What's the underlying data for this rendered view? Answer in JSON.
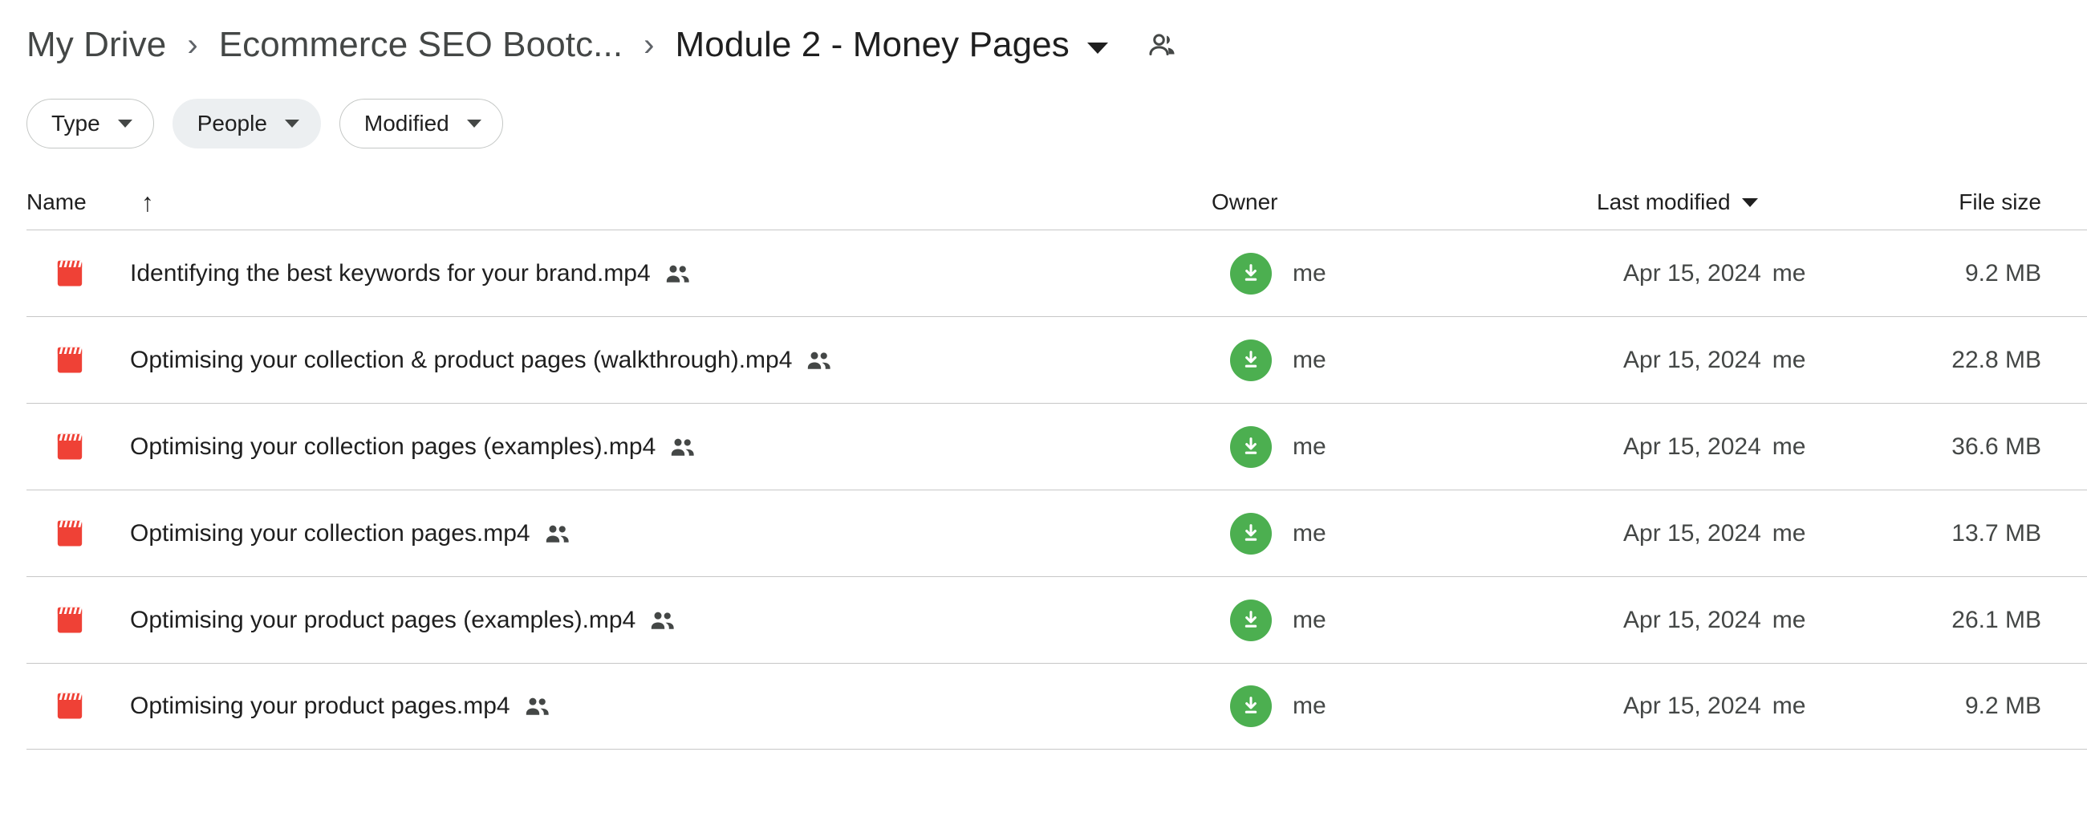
{
  "breadcrumb": {
    "items": [
      {
        "label": "My Drive",
        "icon": ""
      },
      {
        "label": "Ecommerce SEO Bootc...",
        "icon": ""
      },
      {
        "label": "Module 2 - Money Pages",
        "icon": "chevron-down-icon"
      }
    ],
    "separator": "›",
    "share_icon": "people-shared-icon"
  },
  "filters": {
    "chips": [
      {
        "label": "Type",
        "active": false,
        "icon": "chevron-down-icon"
      },
      {
        "label": "People",
        "active": true,
        "icon": "chevron-down-icon"
      },
      {
        "label": "Modified",
        "active": false,
        "icon": "chevron-down-icon"
      }
    ]
  },
  "columns": {
    "name": "Name",
    "name_sort_icon": "arrow-up-icon",
    "name_sort_glyph": "↑",
    "owner": "Owner",
    "modified": "Last modified",
    "modified_sort_icon": "chevron-down-icon",
    "size": "File size"
  },
  "colors": {
    "video_icon": "#EF4136",
    "avatar_bg": "#4CAF50",
    "chip_active_bg": "#eceff1",
    "divider": "#c7c7c7",
    "text_primary": "#1f1f1f",
    "text_secondary": "#444746"
  },
  "files": [
    {
      "icon": "video-file-icon",
      "name": "Identifying the best keywords for your brand.mp4",
      "shared_icon": "people-icon",
      "owner_avatar_icon": "download-arrow-icon",
      "owner": "me",
      "modified": "Apr 15, 2024",
      "modified_by": "me",
      "size": "9.2 MB"
    },
    {
      "icon": "video-file-icon",
      "name": "Optimising your collection & product pages (walkthrough).mp4",
      "shared_icon": "people-icon",
      "owner_avatar_icon": "download-arrow-icon",
      "owner": "me",
      "modified": "Apr 15, 2024",
      "modified_by": "me",
      "size": "22.8 MB"
    },
    {
      "icon": "video-file-icon",
      "name": "Optimising your collection pages (examples).mp4",
      "shared_icon": "people-icon",
      "owner_avatar_icon": "download-arrow-icon",
      "owner": "me",
      "modified": "Apr 15, 2024",
      "modified_by": "me",
      "size": "36.6 MB"
    },
    {
      "icon": "video-file-icon",
      "name": "Optimising your collection pages.mp4",
      "shared_icon": "people-icon",
      "owner_avatar_icon": "download-arrow-icon",
      "owner": "me",
      "modified": "Apr 15, 2024",
      "modified_by": "me",
      "size": "13.7 MB"
    },
    {
      "icon": "video-file-icon",
      "name": "Optimising your product pages (examples).mp4",
      "shared_icon": "people-icon",
      "owner_avatar_icon": "download-arrow-icon",
      "owner": "me",
      "modified": "Apr 15, 2024",
      "modified_by": "me",
      "size": "26.1 MB"
    },
    {
      "icon": "video-file-icon",
      "name": "Optimising your product pages.mp4",
      "shared_icon": "people-icon",
      "owner_avatar_icon": "download-arrow-icon",
      "owner": "me",
      "modified": "Apr 15, 2024",
      "modified_by": "me",
      "size": "9.2 MB"
    }
  ]
}
